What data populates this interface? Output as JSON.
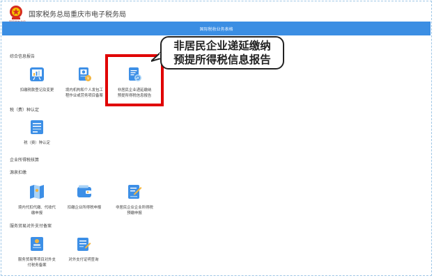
{
  "header": {
    "emblem_text": "国家税务总局",
    "title": "国家税务总局重庆市电子税务局"
  },
  "banner": {
    "title": "国际税收业务表格"
  },
  "sections": {
    "comprehensive": "综合信息报告",
    "tax_type": "税（费）种认定",
    "enterprise_income": "企业所得税核算",
    "withholding": "源泉扣缴",
    "service_trade": "服务贸易对外支付备案"
  },
  "items": {
    "item1": {
      "line1": "扣缴税款登记及变更",
      "line2": ""
    },
    "item2": {
      "line1": "境内机构和个人发包工",
      "line2": "程作业或劳务项目备案"
    },
    "item3": {
      "line1": "非居民企业递延缴纳",
      "line2": "预提所得税信息报告"
    },
    "item4": {
      "line1": "税（费）种认定",
      "line2": ""
    },
    "item5": {
      "line1": "境内代扣代缴、代收代",
      "line2": "缴申报"
    },
    "item6": {
      "line1": "扣缴企业所得税申报",
      "line2": ""
    },
    "item7": {
      "line1": "非居民企业企业所得税",
      "line2": "预缴申报"
    },
    "item8": {
      "line1": "服务贸易等项目对外支",
      "line2": "付税务备案"
    },
    "item9": {
      "line1": "对外支付证明查询",
      "line2": ""
    }
  },
  "callout": {
    "line1": "非居民企业递延缴纳",
    "line2": "预提所得税信息报告"
  },
  "icons": {
    "emblem": "national-emblem-icon",
    "item1": "presentation-board-icon",
    "item2": "document-coin-icon",
    "item3": "document-refresh-icon",
    "item4": "form-list-icon",
    "item5": "map-folded-icon",
    "item6": "wallet-icon",
    "item7": "document-pen-icon",
    "item8": "form-person-icon",
    "item9": "notepad-pen-icon"
  },
  "colors": {
    "banner": "#3b8ee3",
    "highlight": "#e00000",
    "icon_blue": "#3d8fe6",
    "icon_light": "#a9d3f7",
    "icon_yellow": "#f2b540"
  }
}
